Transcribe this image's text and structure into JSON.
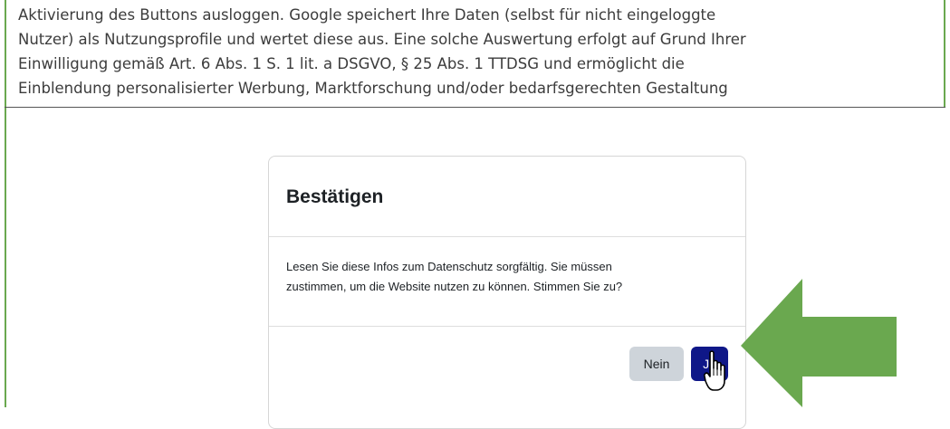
{
  "policy": {
    "lines": [
      "Aktivierung des Buttons ausloggen. Google speichert Ihre Daten (selbst für nicht eingeloggte",
      "Nutzer) als Nutzungsprofile und wertet diese aus. Eine solche Auswertung erfolgt auf Grund Ihrer",
      "Einwilligung gemäß Art. 6 Abs. 1 S. 1 lit. a DSGVO, § 25 Abs. 1 TTDSG und ermöglicht die",
      "Einblendung personalisierter Werbung, Marktforschung und/oder bedarfsgerechten Gestaltung"
    ]
  },
  "dialog": {
    "title": "Bestätigen",
    "message_line1": "Lesen Sie diese Infos zum Datenschutz sorgfältig. Sie müssen",
    "message_line2": "zustimmen, um die Website nutzen zu können. Stimmen Sie zu?",
    "no_label": "Nein",
    "yes_label": "Ja"
  },
  "colors": {
    "frame": "#6aa84f",
    "arrow": "#6aa84f",
    "yes_button": "#0f1788",
    "no_button": "#ced4da"
  },
  "icons": {
    "cursor": "hand-pointer-cursor-icon",
    "arrow": "left-arrow-icon"
  }
}
